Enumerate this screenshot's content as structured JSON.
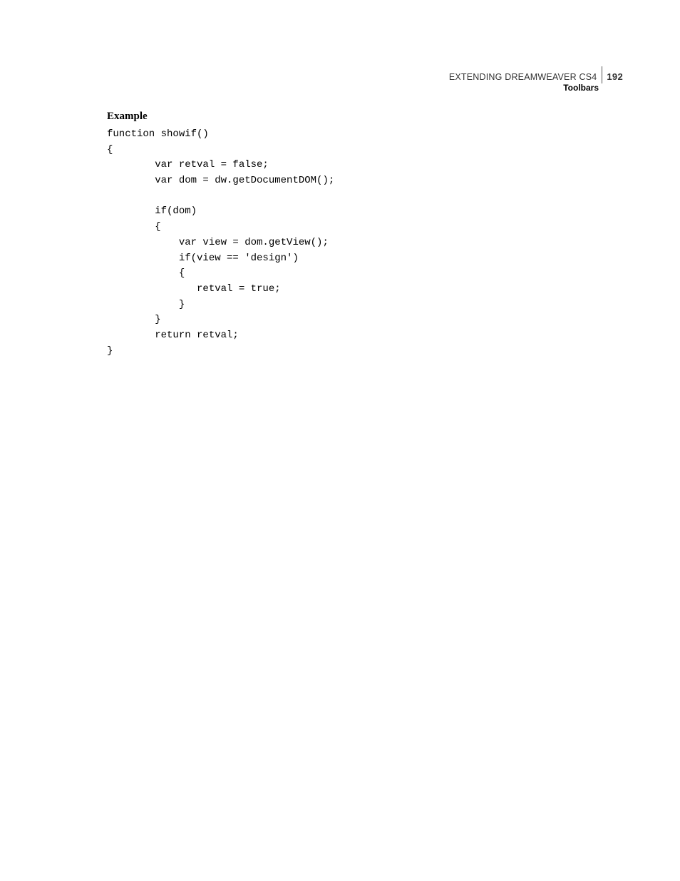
{
  "header": {
    "title": "EXTENDING DREAMWEAVER CS4",
    "page": "192",
    "subtitle": "Toolbars"
  },
  "section": {
    "heading": "Example",
    "code": "function showif()\n{\n        var retval = false;\n        var dom = dw.getDocumentDOM();\n\n        if(dom)\n        {\n            var view = dom.getView();\n            if(view == 'design')\n            {\n               retval = true;\n            }\n        }\n        return retval;\n}"
  }
}
